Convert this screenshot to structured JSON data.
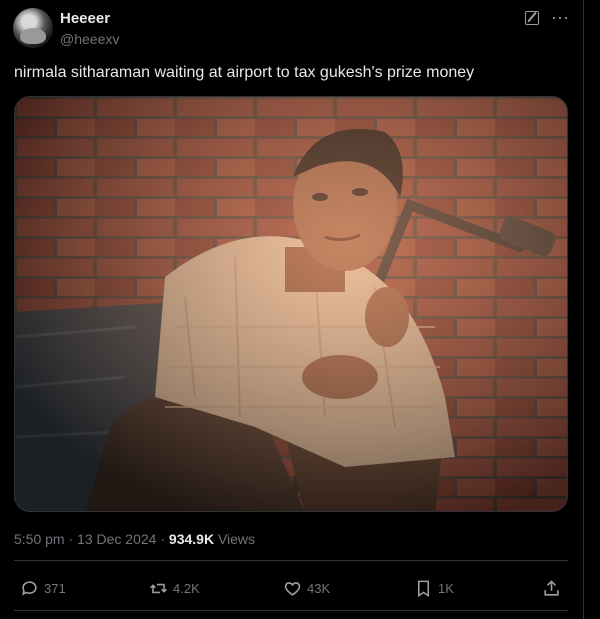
{
  "author": {
    "name": "Heeeer",
    "handle": "@heeexv"
  },
  "tweet": {
    "text": "nirmala sitharaman waiting at airport to tax gukesh's prize money"
  },
  "meta": {
    "time": "5:50 pm",
    "date": "13 Dec 2024",
    "separator": "·",
    "views_count": "934.9K",
    "views_label": "Views"
  },
  "actions": {
    "replies": "371",
    "reposts": "4.2K",
    "likes": "43K",
    "bookmarks": "1K"
  },
  "icons": {
    "edit": "edit-icon",
    "more": "more-icon",
    "reply": "reply-icon",
    "repost": "repost-icon",
    "like": "heart-icon",
    "bookmark": "bookmark-icon",
    "share": "share-icon"
  },
  "colors": {
    "background": "#000000",
    "text": "#e7e9ea",
    "muted": "#71767b",
    "border": "#2f3336"
  }
}
